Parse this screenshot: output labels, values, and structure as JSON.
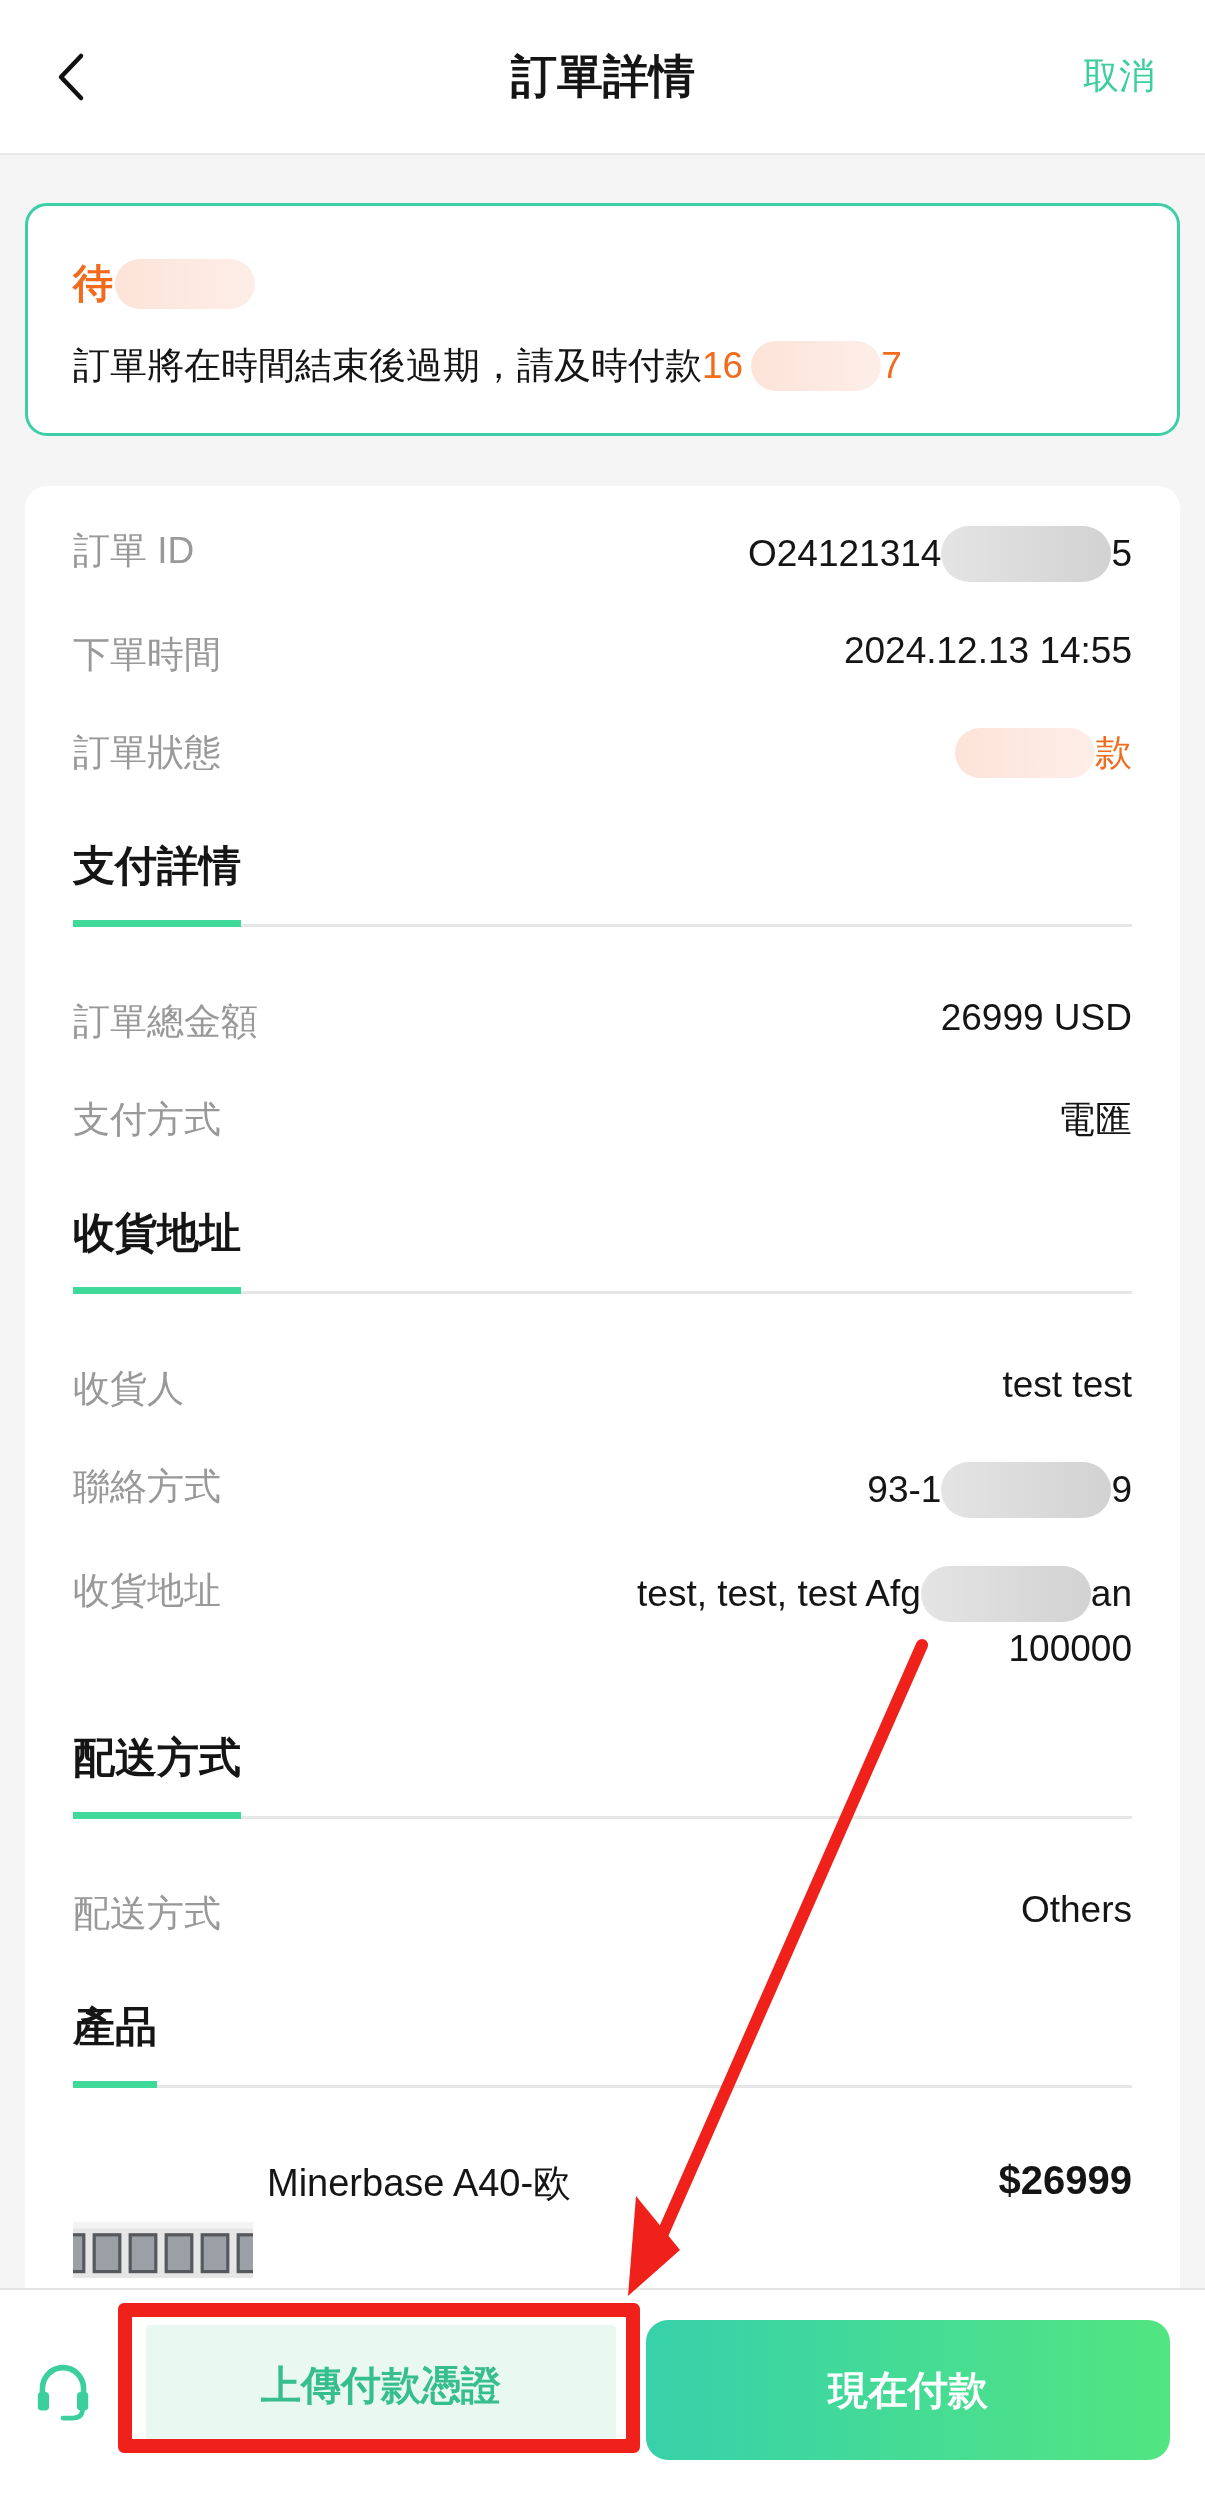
{
  "header": {
    "title": "訂單詳情",
    "action": "取消"
  },
  "notice": {
    "title": [
      {
        "text": "待"
      },
      {
        "kind": "redaction"
      }
    ],
    "message": "訂單將在時間結束後過期，請及時付款",
    "countdown": [
      {
        "text": "16"
      },
      {
        "kind": "redaction"
      },
      {
        "text": "7"
      }
    ]
  },
  "sections": [
    {
      "rows": [
        {
          "label": "訂單 ID",
          "accent": false,
          "value": [
            {
              "text": "O24121314"
            },
            {
              "kind": "redaction"
            },
            {
              "text": "5"
            }
          ]
        },
        {
          "label": "下單時間",
          "accent": false,
          "value": [
            {
              "text": "2024.12.13 14:55"
            }
          ]
        },
        {
          "label": "訂單狀態",
          "accent": true,
          "value": [
            {
              "kind": "redaction"
            },
            {
              "text": "款"
            }
          ]
        }
      ]
    },
    {
      "title": "支付詳情",
      "rows": [
        {
          "label": "訂單總金額",
          "accent": false,
          "value": [
            {
              "text": "26999 USD"
            }
          ]
        },
        {
          "label": "支付方式",
          "accent": false,
          "value": [
            {
              "text": "電匯"
            }
          ]
        }
      ]
    },
    {
      "title": "收貨地址",
      "rows": [
        {
          "label": "收貨人",
          "accent": false,
          "value": [
            {
              "text": "test test"
            }
          ]
        },
        {
          "label": "聯絡方式",
          "accent": false,
          "value": [
            {
              "text": "93-1"
            },
            {
              "kind": "redaction"
            },
            {
              "text": "9"
            }
          ]
        },
        {
          "label": "收貨地址",
          "accent": false,
          "value": [
            {
              "text": "test, test, test Afg"
            },
            {
              "kind": "redaction"
            },
            {
              "text": "an"
            }
          ],
          "extra_line": "100000"
        }
      ]
    },
    {
      "title": "配送方式",
      "rows": [
        {
          "label": "配送方式",
          "accent": false,
          "value": [
            {
              "text": "Others"
            }
          ]
        }
      ]
    },
    {
      "title": "產品",
      "product": {
        "name": "Minerbase A40-欧",
        "price": "$26999"
      }
    }
  ],
  "bottom_bar": {
    "secondary_button": "上傳付款憑證",
    "primary_button": "現在付款"
  }
}
